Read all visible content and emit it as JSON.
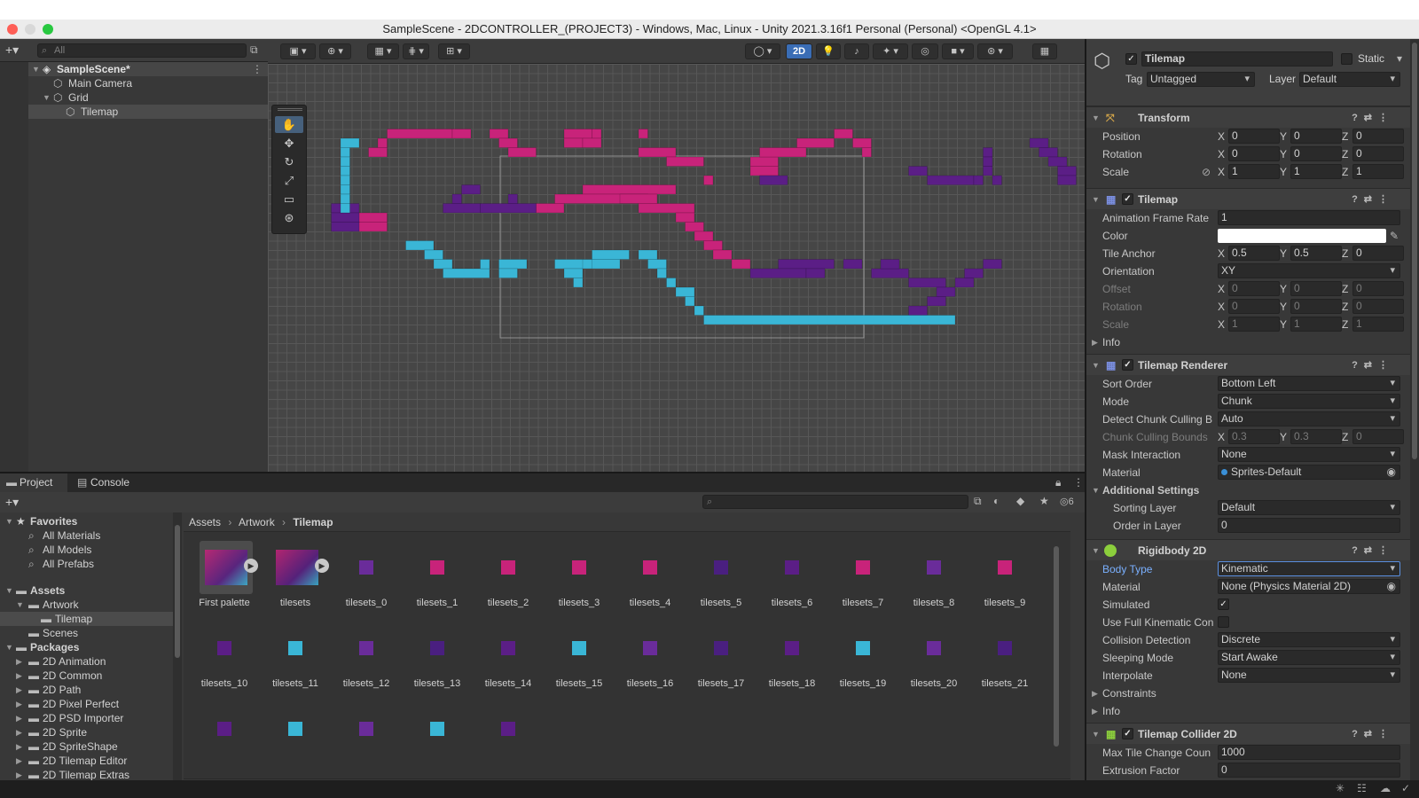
{
  "window": {
    "title": "SampleScene - 2DCONTROLLER_(PROJECT3) - Windows, Mac, Linux - Unity 2021.3.16f1 Personal (Personal) <OpenGL 4.1>"
  },
  "hierarchy": {
    "search_placeholder": "All",
    "items": [
      {
        "label": "SampleScene*"
      },
      {
        "label": "Main Camera"
      },
      {
        "label": "Grid"
      },
      {
        "label": "Tilemap"
      }
    ]
  },
  "scene_toolbar": {
    "mode_2d": "2D",
    "gizmo_count": "6"
  },
  "bottom": {
    "tabs": [
      "Project",
      "Console"
    ],
    "favorites_header": "Favorites",
    "favorites": [
      "All Materials",
      "All Models",
      "All Prefabs"
    ],
    "assets_header": "Assets",
    "asset_folders": [
      "Artwork",
      "Tilemap",
      "Scenes"
    ],
    "packages_header": "Packages",
    "packages": [
      "2D Animation",
      "2D Common",
      "2D Path",
      "2D Pixel Perfect",
      "2D PSD Importer",
      "2D Sprite",
      "2D SpriteShape",
      "2D Tilemap Editor",
      "2D Tilemap Extras"
    ],
    "breadcrumb": [
      "Assets",
      "Artwork",
      "Tilemap"
    ],
    "search_placeholder": "",
    "assets": [
      "First palette",
      "tilesets",
      "tilesets_0",
      "tilesets_1",
      "tilesets_2",
      "tilesets_3",
      "tilesets_4",
      "tilesets_5",
      "tilesets_6",
      "tilesets_7",
      "tilesets_8",
      "tilesets_9",
      "tilesets_10",
      "tilesets_11",
      "tilesets_12",
      "tilesets_13",
      "tilesets_14",
      "tilesets_15",
      "tilesets_16",
      "tilesets_17",
      "tilesets_18",
      "tilesets_19",
      "tilesets_20",
      "tilesets_21",
      "",
      "",
      "",
      "",
      ""
    ],
    "visibility_count": "6"
  },
  "inspector": {
    "object_name": "Tilemap",
    "static_label": "Static",
    "tag_label": "Tag",
    "tag_value": "Untagged",
    "layer_label": "Layer",
    "layer_value": "Default",
    "transform": {
      "title": "Transform",
      "position": {
        "label": "Position",
        "x": "0",
        "y": "0",
        "z": "0"
      },
      "rotation": {
        "label": "Rotation",
        "x": "0",
        "y": "0",
        "z": "0"
      },
      "scale": {
        "label": "Scale",
        "x": "1",
        "y": "1",
        "z": "1"
      }
    },
    "tilemap": {
      "title": "Tilemap",
      "animation_frame_rate": {
        "label": "Animation Frame Rate",
        "value": "1"
      },
      "color": {
        "label": "Color",
        "value": "#ffffff"
      },
      "tile_anchor": {
        "label": "Tile Anchor",
        "x": "0.5",
        "y": "0.5",
        "z": "0"
      },
      "orientation": {
        "label": "Orientation",
        "value": "XY"
      },
      "offset": {
        "label": "Offset",
        "x": "0",
        "y": "0",
        "z": "0"
      },
      "rotation": {
        "label": "Rotation",
        "x": "0",
        "y": "0",
        "z": "0"
      },
      "scale": {
        "label": "Scale",
        "x": "1",
        "y": "1",
        "z": "1"
      },
      "info": "Info"
    },
    "renderer": {
      "title": "Tilemap Renderer",
      "sort_order": {
        "label": "Sort Order",
        "value": "Bottom Left"
      },
      "mode": {
        "label": "Mode",
        "value": "Chunk"
      },
      "detect_chunk": {
        "label": "Detect Chunk Culling B",
        "value": "Auto"
      },
      "chunk_bounds": {
        "label": "Chunk Culling Bounds",
        "x": "0.3",
        "y": "0.3",
        "z": "0"
      },
      "mask_interaction": {
        "label": "Mask Interaction",
        "value": "None"
      },
      "material": {
        "label": "Material",
        "value": "Sprites-Default"
      },
      "additional": "Additional Settings",
      "sorting_layer": {
        "label": "Sorting Layer",
        "value": "Default"
      },
      "order_in_layer": {
        "label": "Order in Layer",
        "value": "0"
      }
    },
    "rigidbody": {
      "title": "Rigidbody 2D",
      "body_type": {
        "label": "Body Type",
        "value": "Kinematic"
      },
      "material": {
        "label": "Material",
        "value": "None (Physics Material 2D)"
      },
      "simulated": {
        "label": "Simulated"
      },
      "use_full_kinematic": {
        "label": "Use Full Kinematic Con"
      },
      "collision_detection": {
        "label": "Collision Detection",
        "value": "Discrete"
      },
      "sleeping_mode": {
        "label": "Sleeping Mode",
        "value": "Start Awake"
      },
      "interpolate": {
        "label": "Interpolate",
        "value": "None"
      },
      "constraints": "Constraints",
      "info": "Info"
    },
    "collider": {
      "title": "Tilemap Collider 2D",
      "max_tile_change": {
        "label": "Max Tile Change Coun",
        "value": "1000"
      },
      "extrusion": {
        "label": "Extrusion Factor",
        "value": "0"
      }
    }
  },
  "colors": {
    "magenta_tile": "#c8237a",
    "purple_tile": "#5b1e86",
    "cyan_tile": "#3ab6d6",
    "accent": "#3a6db5"
  }
}
